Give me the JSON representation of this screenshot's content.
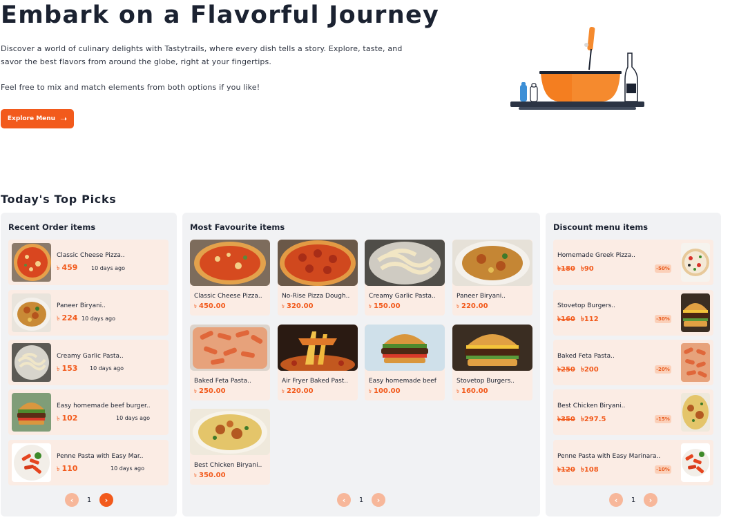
{
  "hero": {
    "title": "Embark on a Flavorful Journey",
    "description": "Discover a world of culinary delights with Tastytrails, where every dish tells a story. Explore, taste, and savor the best flavors from around the globe, right at your fingertips.",
    "note": "Feel free to mix and match elements from both options if you like!",
    "button_label": "Explore Menu",
    "button_icon": "arrow-right-icon"
  },
  "top_picks_title": "Today's Top Picks",
  "currency_symbol": "৳",
  "colors": {
    "accent": "#f25a1c",
    "card_bg": "#fbece4",
    "panel_bg": "#f1f2f4",
    "heading": "#1b2231"
  },
  "recent": {
    "title": "Recent Order items",
    "items": [
      {
        "name": "Classic Cheese Pizza..",
        "price": "459",
        "ago": "10 days ago",
        "image": "pizza"
      },
      {
        "name": "Paneer Biryani..",
        "price": "224",
        "ago": "10 days ago",
        "image": "biryani"
      },
      {
        "name": "Creamy Garlic Pasta..",
        "price": "153",
        "ago": "10 days ago",
        "image": "fettuccine"
      },
      {
        "name": "Easy homemade beef burger..",
        "price": "102",
        "ago": "10 days ago",
        "image": "burger"
      },
      {
        "name": "Penne Pasta with Easy Mar..",
        "price": "110",
        "ago": "10 days ago",
        "image": "penne"
      }
    ],
    "page": "1"
  },
  "favourite": {
    "title": "Most Favourite items",
    "items": [
      {
        "name": "Classic Cheese Pizza..",
        "price": "450.00",
        "image": "pizza"
      },
      {
        "name": "No-Rise Pizza Dough..",
        "price": "320.00",
        "image": "pepperoni"
      },
      {
        "name": "Creamy Garlic Pasta..",
        "price": "150.00",
        "image": "fettuccine"
      },
      {
        "name": "Paneer Biryani..",
        "price": "220.00",
        "image": "biryani"
      },
      {
        "name": "Baked Feta Pasta..",
        "price": "250.00",
        "image": "feta"
      },
      {
        "name": "Air Fryer Baked Past..",
        "price": "220.00",
        "image": "cheesepull"
      },
      {
        "name": "Easy homemade beef",
        "price": "100.00",
        "image": "burger"
      },
      {
        "name": "Stovetop Burgers..",
        "price": "160.00",
        "image": "burger2"
      },
      {
        "name": "Best Chicken Biryani..",
        "price": "350.00",
        "image": "biryani2"
      }
    ],
    "page": "1"
  },
  "discount": {
    "title": "Discount menu items",
    "items": [
      {
        "name": "Homemade Greek Pizza..",
        "old_price": "180",
        "new_price": "90",
        "badge": "-50%",
        "image": "greekpizza"
      },
      {
        "name": "Stovetop Burgers..",
        "old_price": "160",
        "new_price": "112",
        "badge": "-30%",
        "image": "burger2"
      },
      {
        "name": "Baked Feta Pasta..",
        "old_price": "250",
        "new_price": "200",
        "badge": "-20%",
        "image": "feta"
      },
      {
        "name": "Best Chicken Biryani..",
        "old_price": "350",
        "new_price": "297.5",
        "badge": "-15%",
        "image": "biryani2"
      },
      {
        "name": "Penne Pasta with Easy Marinara..",
        "old_price": "120",
        "new_price": "108",
        "badge": "-10%",
        "image": "penne"
      }
    ],
    "page": "1"
  },
  "pager_icons": {
    "prev": "chevron-left-icon",
    "next": "chevron-right-icon"
  }
}
